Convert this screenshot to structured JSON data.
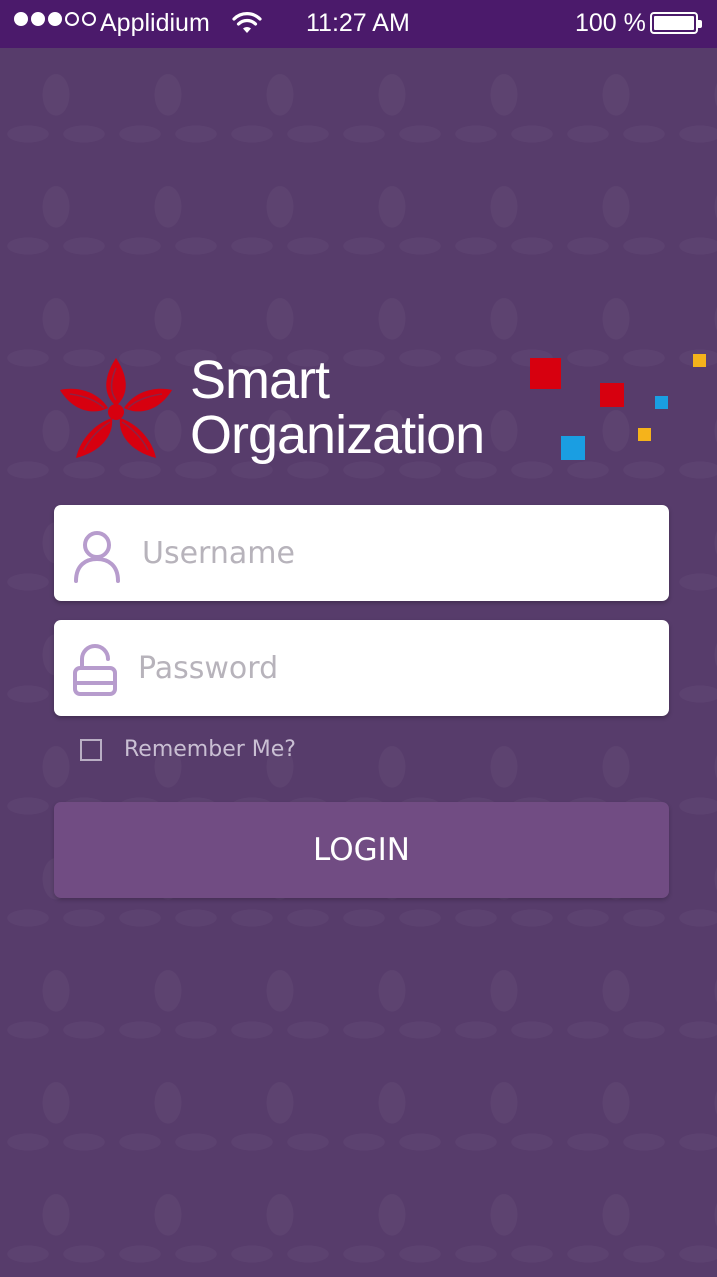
{
  "status_bar": {
    "carrier": "Applidium",
    "time": "11:27 AM",
    "battery_percent": "100 %",
    "signal_bars_filled": 3,
    "signal_bars_total": 5
  },
  "brand": {
    "line1": "Smart",
    "line2": "Organization",
    "logo_icon": "bauhinia-flower-icon",
    "colors": {
      "red": "#d7000f",
      "blue": "#1a9ee2",
      "yellow": "#f5b31b"
    }
  },
  "login_form": {
    "username_placeholder": "Username",
    "username_value": "",
    "password_placeholder": "Password",
    "password_value": "",
    "remember_label": "Remember Me?",
    "remember_checked": false,
    "login_label": "LOGIN"
  },
  "theme": {
    "background": "#573c6b",
    "status_bar": "#4b1a6b",
    "button": "#714c83",
    "icon_color": "#b79ccd"
  }
}
